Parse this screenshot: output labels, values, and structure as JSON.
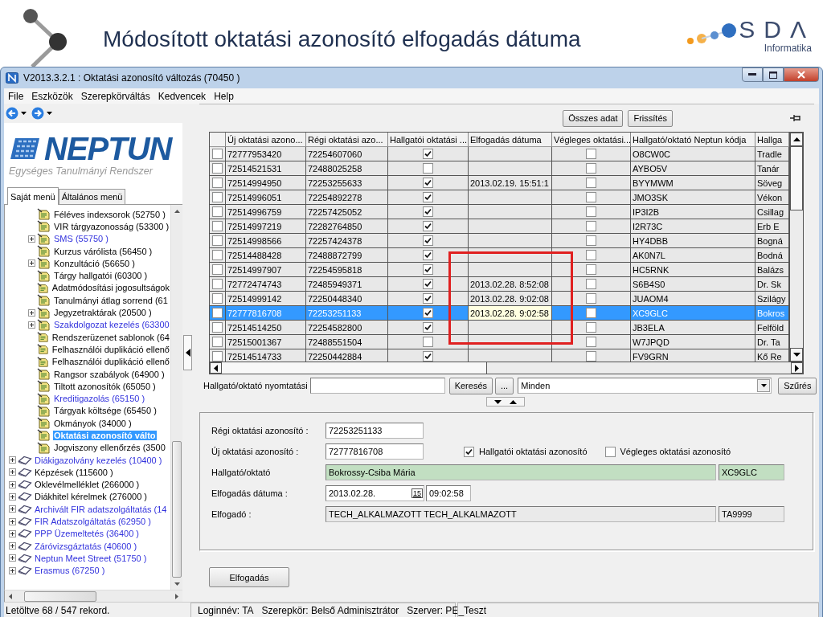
{
  "slide": {
    "title": "Módosított oktatási azonosító elfogadás dátuma",
    "logo": {
      "mark": "SDΛ",
      "caption": "Informatika"
    }
  },
  "window": {
    "title": "V2013.3.2.1 : Oktatási azonosító változás (70450 )"
  },
  "menu": [
    "File",
    "Eszközök",
    "Szerepkörváltás",
    "Kedvencek",
    "Help"
  ],
  "sidebar": {
    "logo": {
      "name": "NEPTUN",
      "tagline": "Egységes Tanulmányi Rendszer"
    },
    "tabs": [
      {
        "label": "Saját menü",
        "selected": true
      },
      {
        "label": "Általános menü",
        "selected": false
      }
    ],
    "tree": [
      {
        "children": [
          {
            "label": "Féléves indexsorok (52750 )",
            "kind": "page",
            "link": false,
            "expandable": false,
            "selected": false
          },
          {
            "label": "VIR tárgyazonosság (53300 )",
            "kind": "page",
            "link": false,
            "expandable": false,
            "selected": false
          },
          {
            "label": "SMS (55750 )",
            "kind": "page",
            "link": true,
            "expandable": true,
            "selected": false
          },
          {
            "label": "Kurzus várólista (56450 )",
            "kind": "page",
            "link": false,
            "expandable": false,
            "selected": false
          },
          {
            "label": "Konzultáció (56650 )",
            "kind": "page",
            "link": false,
            "expandable": true,
            "selected": false
          },
          {
            "label": "Tárgy hallgatói (60300 )",
            "kind": "page",
            "link": false,
            "expandable": false,
            "selected": false
          },
          {
            "label": "Adatmódosítási jogosultságok",
            "kind": "page",
            "link": false,
            "expandable": false,
            "selected": false
          },
          {
            "label": "Tanulmányi átlag sorrend (61",
            "kind": "page",
            "link": false,
            "expandable": false,
            "selected": false
          },
          {
            "label": "Jegyzetraktárak (20500 )",
            "kind": "page",
            "link": false,
            "expandable": true,
            "selected": false
          },
          {
            "label": "Szakdolgozat kezelés (63300",
            "kind": "page",
            "link": true,
            "expandable": true,
            "selected": false
          },
          {
            "label": "Rendszerüzenet sablonok (64",
            "kind": "page",
            "link": false,
            "expandable": false,
            "selected": false
          },
          {
            "label": "Felhasználói duplikáció ellenő",
            "kind": "page",
            "link": false,
            "expandable": false,
            "selected": false
          },
          {
            "label": "Felhasználói duplikáció ellenő",
            "kind": "page",
            "link": false,
            "expandable": false,
            "selected": false
          },
          {
            "label": "Rangsor szabályok (64900 )",
            "kind": "page",
            "link": false,
            "expandable": false,
            "selected": false
          },
          {
            "label": "Tiltott azonosítók (65050 )",
            "kind": "page",
            "link": false,
            "expandable": false,
            "selected": false
          },
          {
            "label": "Kreditigazolás (65150 )",
            "kind": "page",
            "link": true,
            "expandable": false,
            "selected": false
          },
          {
            "label": "Tárgyak költsége (65450 )",
            "kind": "page",
            "link": false,
            "expandable": false,
            "selected": false
          },
          {
            "label": "Okmányok (34000 )",
            "kind": "page",
            "link": false,
            "expandable": false,
            "selected": false
          },
          {
            "label": "Oktatási azonosító válto",
            "kind": "page",
            "link": false,
            "expandable": false,
            "selected": true
          },
          {
            "label": "Jogviszony ellenőrzés (3500",
            "kind": "page",
            "link": false,
            "expandable": false,
            "selected": false
          }
        ]
      },
      {
        "label": "Diákigazolvány kezelés (10400 )",
        "kind": "module",
        "link": true,
        "expandable": true,
        "selected": false
      },
      {
        "label": "Képzések (115600 )",
        "kind": "module",
        "link": false,
        "expandable": true,
        "selected": false
      },
      {
        "label": "Oklevélmelléklet (266000 )",
        "kind": "module",
        "link": false,
        "expandable": true,
        "selected": false
      },
      {
        "label": "Diákhitel kérelmek (276000 )",
        "kind": "module",
        "link": false,
        "expandable": true,
        "selected": false
      },
      {
        "label": "Archivált FIR adatszolgáltatás (14",
        "kind": "module",
        "link": true,
        "expandable": true,
        "selected": false
      },
      {
        "label": "FIR Adatszolgáltatás (62950 )",
        "kind": "module",
        "link": true,
        "expandable": true,
        "selected": false
      },
      {
        "label": "PPP Üzemeltetés (36400 )",
        "kind": "module",
        "link": true,
        "expandable": true,
        "selected": false
      },
      {
        "label": "Záróvizsgáztatás (40600 )",
        "kind": "module",
        "link": true,
        "expandable": true,
        "selected": false
      },
      {
        "label": "Neptun Meet Street (51750 )",
        "kind": "module",
        "link": true,
        "expandable": true,
        "selected": false
      },
      {
        "label": "Erasmus (67250 )",
        "kind": "module",
        "link": true,
        "expandable": true,
        "selected": false
      }
    ]
  },
  "toolbar": {
    "buttons": [
      "Összes adat",
      "Frissítés"
    ]
  },
  "table": {
    "columns": [
      "Új oktatási azono...",
      "Régi oktatási azo...",
      "Hallgatói oktatási ...",
      "Elfogadás dátuma",
      "Végleges oktatási...",
      "Hallgató/oktató Neptun kódja",
      "Hallga"
    ],
    "rows": [
      {
        "marked": false,
        "new_id": "72777953420",
        "old_id": "72254607060",
        "student_id": true,
        "final_id": false,
        "neptun_code": "O8CW0C",
        "column_8": "Tradle",
        "selected": false
      },
      {
        "marked": false,
        "new_id": "72514521531",
        "old_id": "72488025258",
        "student_id": false,
        "final_id": false,
        "neptun_code": "AYBO5V",
        "column_8": "Tanár",
        "selected": false
      },
      {
        "marked": false,
        "new_id": "72514994950",
        "old_id": "72253255633",
        "student_id": true,
        "accepted_at": "2013.02.19. 15:51:1",
        "final_id": false,
        "neptun_code": "BYYMWM",
        "column_8": "Söveg",
        "selected": false
      },
      {
        "marked": false,
        "new_id": "72514996051",
        "old_id": "72254892278",
        "student_id": true,
        "final_id": false,
        "neptun_code": "JMO3SK",
        "column_8": "Vékon",
        "selected": false
      },
      {
        "marked": false,
        "new_id": "72514996759",
        "old_id": "72257425052",
        "student_id": true,
        "final_id": false,
        "neptun_code": "IP3I2B",
        "column_8": "Csillag",
        "selected": false
      },
      {
        "marked": false,
        "new_id": "72514997219",
        "old_id": "72282764850",
        "student_id": true,
        "final_id": false,
        "neptun_code": "I2R73C",
        "column_8": "Erb E",
        "selected": false
      },
      {
        "marked": false,
        "new_id": "72514998566",
        "old_id": "72257424378",
        "student_id": true,
        "final_id": false,
        "neptun_code": "HY4DBB",
        "column_8": "Bogná",
        "selected": false
      },
      {
        "marked": false,
        "new_id": "72514488428",
        "old_id": "72488872799",
        "student_id": true,
        "final_id": false,
        "neptun_code": "AK0N7L",
        "column_8": "Bodná",
        "selected": false
      },
      {
        "marked": false,
        "new_id": "72514997907",
        "old_id": "72254595818",
        "student_id": true,
        "final_id": false,
        "neptun_code": "HC5RNK",
        "column_8": "Balázs",
        "selected": false
      },
      {
        "marked": false,
        "new_id": "72772474743",
        "old_id": "72485949371",
        "student_id": true,
        "accepted_at": "2013.02.28. 8:52:08",
        "final_id": false,
        "neptun_code": "S6B4S0",
        "column_8": "Dr. Sk",
        "selected": false
      },
      {
        "marked": false,
        "new_id": "72514999142",
        "old_id": "72250448340",
        "student_id": true,
        "accepted_at": "2013.02.28. 9:02:08",
        "final_id": false,
        "neptun_code": "JUAOM4",
        "column_8": "Szilágy",
        "selected": false
      },
      {
        "marked": false,
        "new_id": "72777816708",
        "old_id": "72253251133",
        "student_id": true,
        "accepted_at": "2013.02.28. 9:02:58",
        "final_id": false,
        "neptun_code": "XC9GLC",
        "column_8": "Bokros",
        "selected": true
      },
      {
        "marked": false,
        "new_id": "72514514250",
        "old_id": "72254582800",
        "student_id": true,
        "final_id": false,
        "neptun_code": "JB3ELA",
        "column_8": "Felföld",
        "selected": false
      },
      {
        "marked": false,
        "new_id": "72515001367",
        "old_id": "72488551504",
        "student_id": false,
        "final_id": false,
        "neptun_code": "W7JPQD",
        "column_8": "Dr. Ta",
        "selected": false
      },
      {
        "marked": false,
        "new_id": "72514514733",
        "old_id": "72250442884",
        "student_id": true,
        "final_id": false,
        "neptun_code": "FV9GRN",
        "column_8": "Kő Re",
        "selected": false
      }
    ]
  },
  "filter": {
    "label": "Hallgató/oktató nyomtatási",
    "search_button": "Keresés",
    "more_button": "...",
    "dropdown": "Minden",
    "filter_button": "Szűrés"
  },
  "detail": {
    "old_id": {
      "label": "Régi oktatási azonosító :",
      "value": "72253251133"
    },
    "new_id": {
      "label": "Új oktatási azonosító :",
      "value": "72777816708"
    },
    "checkboxes": [
      {
        "label": "Hallgatói oktatási azonosító",
        "checked": true
      },
      {
        "label": "Végleges oktatási azonosító",
        "checked": false
      }
    ],
    "person": {
      "label": "Hallgató/oktató",
      "name": "Bokrossy-Csiba Mária",
      "code": "XC9GLC"
    },
    "date": {
      "label": "Elfogadás dátuma :",
      "date": "2013.02.28.",
      "calendar_day": "15",
      "time": "09:02:58"
    },
    "acceptor": {
      "label": "Elfogadó :",
      "name": "TECH_ALKALMAZOTT TECH_ALKALMAZOTT",
      "code": "TA9999"
    },
    "button": "Elfogadás"
  },
  "status_bar": {
    "records": "Letöltve 68 / 547 rekord.",
    "items": [
      "Loginnév: TA",
      "Szerepkör: Belső Adminisztrátor",
      "Szerver: PE_Teszt"
    ]
  }
}
